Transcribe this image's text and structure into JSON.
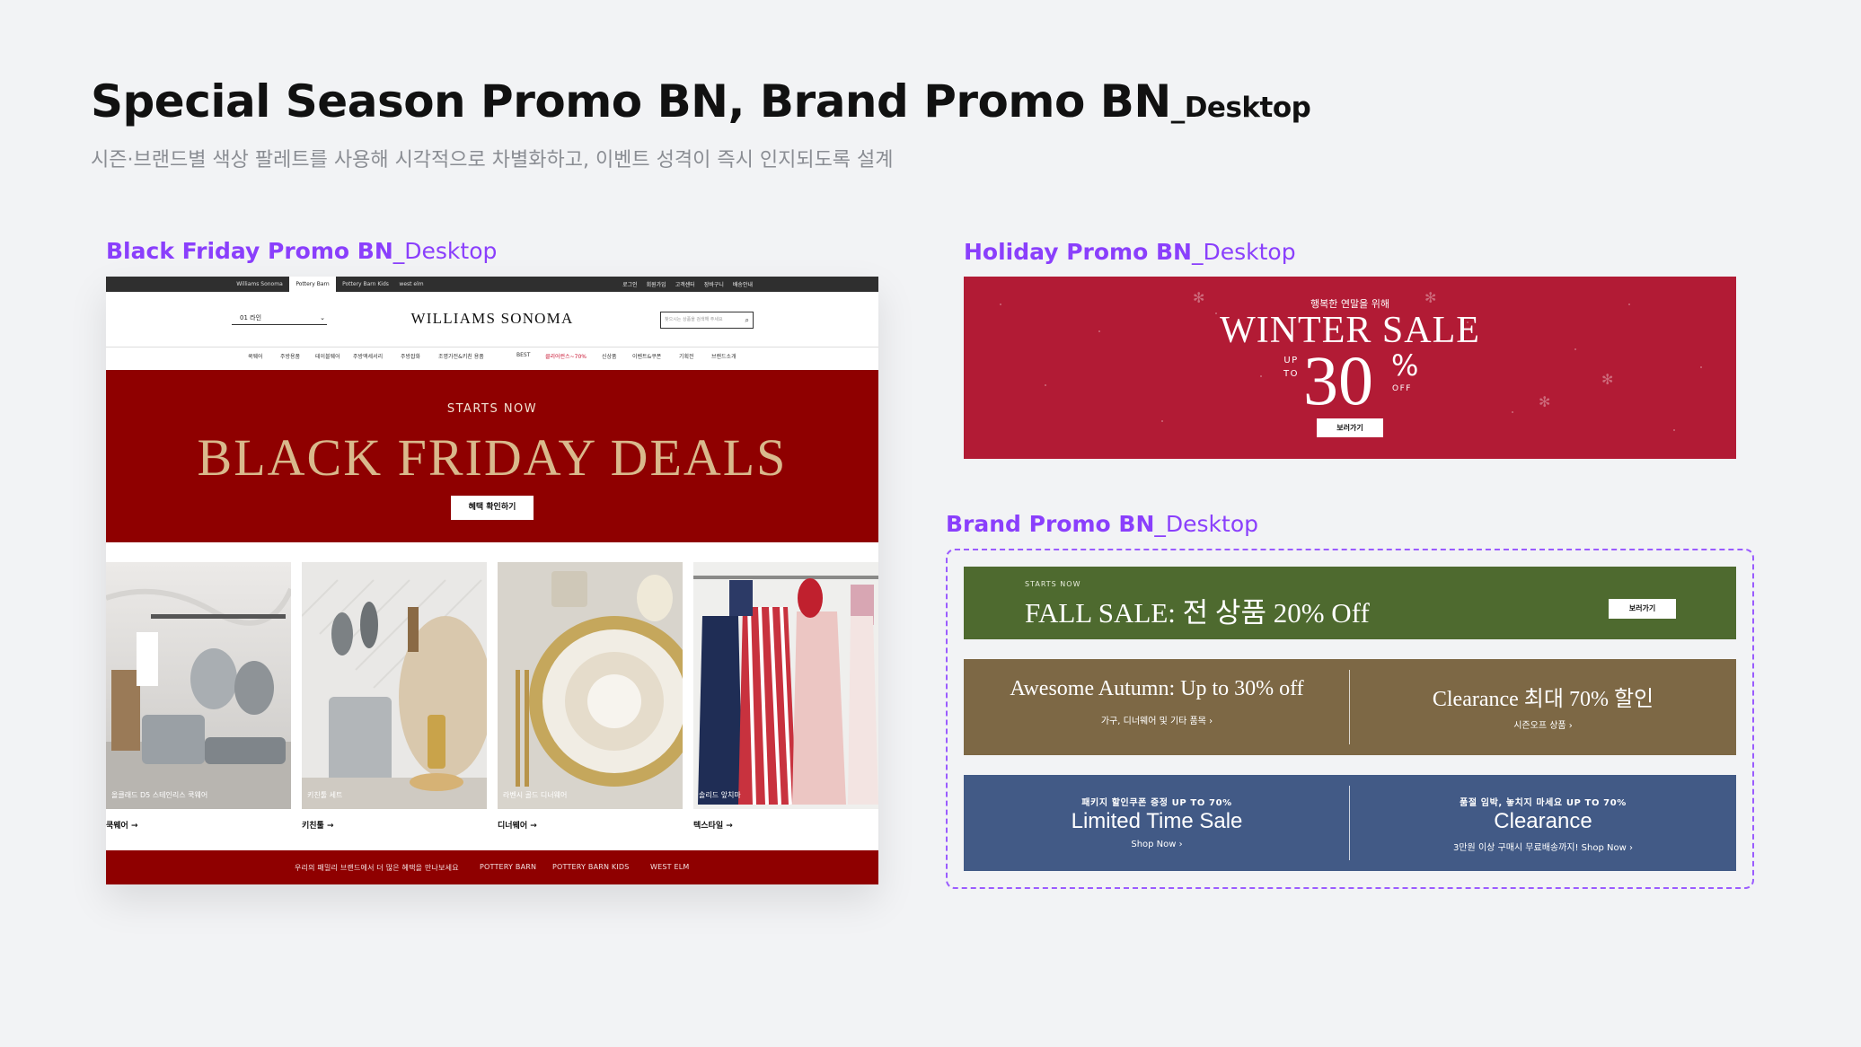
{
  "page": {
    "title": "Special Season Promo BN, Brand Promo BN",
    "title_suffix": "_Desktop",
    "subtitle": "시즌·브랜드별 색상 팔레트를 사용해 시각적으로 차별화하고, 이벤트 성격이 즉시 인지되도록 설계"
  },
  "sections": {
    "black_friday": {
      "label": "Black Friday Promo BN",
      "label_suffix": "_Desktop"
    },
    "holiday": {
      "label": "Holiday Promo BN",
      "label_suffix": "_Desktop"
    },
    "brand": {
      "label": "Brand Promo BN",
      "label_suffix": "_Desktop"
    }
  },
  "bf": {
    "brand_tabs": [
      "Williams Sonoma",
      "Pottery Barn",
      "Pottery Barn Kids",
      "west elm"
    ],
    "active_brand_tab": 1,
    "utility_links": [
      "로그인",
      "회원가입",
      "고객센터",
      "장바구니",
      "배송안내"
    ],
    "store_select": "01  라인",
    "logo": "WILLIAMS SONOMA",
    "search_placeholder": "찾으시는 상품을 검색해 주세요",
    "nav_items": [
      "쿡웨어",
      "주방용품",
      "테이블웨어",
      "주방액세서리",
      "주방잡화",
      "조명가전&키친 용품",
      "BEST",
      "클리어런스~70%",
      "신상품",
      "이벤트&쿠폰",
      "기획전",
      "브랜드소개"
    ],
    "hero": {
      "kicker": "STARTS NOW",
      "headline": "BLACK FRIDAY DEALS",
      "cta": "혜택 확인하기",
      "bg_color": "#8f0000",
      "headline_color": "#d9b98c"
    },
    "categories": [
      {
        "caption": "올클래드 D5 스테인리스 쿡웨어",
        "link": "쿡웨어 →"
      },
      {
        "caption": "키친툴 세트 ",
        "link": "키친툴 →"
      },
      {
        "caption": "라벤시 골드 디너웨어",
        "link": "디너웨어 →"
      },
      {
        "caption": "솔리드 앞치마",
        "link": "텍스타일 →"
      }
    ],
    "footer": {
      "message": "우리의 패밀리 브랜드에서 더 많은 혜택을 만나보세요",
      "links": [
        "POTTERY BARN",
        "POTTERY BARN KIDS",
        "WEST ELM"
      ]
    }
  },
  "holiday": {
    "kicker": "행복한 연말을 위해",
    "title": "WINTER SALE",
    "up_to": [
      "UP",
      "TO"
    ],
    "number": "30",
    "percent": "%",
    "off": "OFF",
    "cta": "보러가기",
    "bg_color": "#b21b35"
  },
  "brand": {
    "banner1": {
      "kicker": "STARTS NOW",
      "headline": "FALL SALE: 전 상품 20% Off",
      "cta": "보러가기",
      "bg_color": "#4e6a2f"
    },
    "banner2": {
      "bg_color": "#7d6845",
      "left": {
        "headline": "Awesome Autumn: Up to 30% off",
        "sub": "가구, 디너웨어 및 기타 품목 ›"
      },
      "right": {
        "headline": "Clearance 최대 70% 할인",
        "sub": "시즌오프 상품 ›"
      }
    },
    "banner3": {
      "bg_color": "#425a86",
      "left": {
        "kicker": "패키지 할인쿠폰 증정 UP TO 70%",
        "headline": "Limited Time Sale",
        "sub": "Shop Now ›"
      },
      "right": {
        "kicker": "품절 임박, 놓치지 마세요 UP TO 70%",
        "headline": "Clearance",
        "sub": "3만원 이상 구매시 무료배송까지! Shop Now ›"
      }
    }
  }
}
